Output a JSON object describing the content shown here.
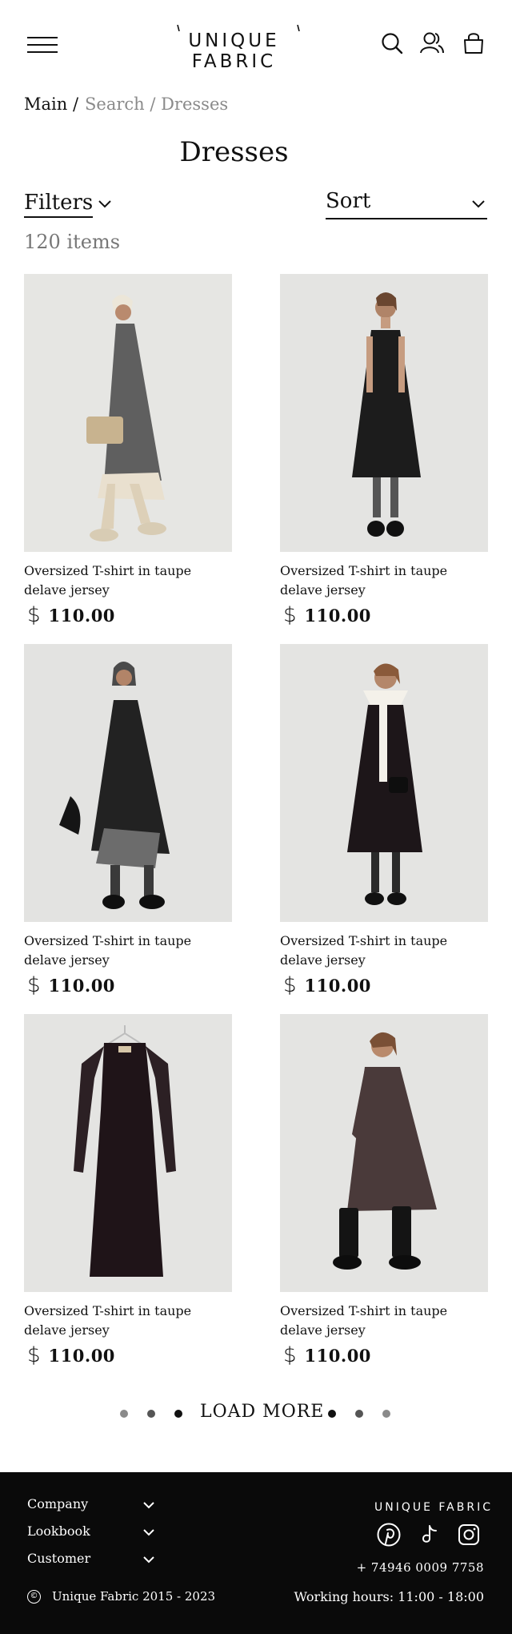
{
  "header": {
    "logo": "UNIQUE FABRIC",
    "icons": [
      "menu-icon",
      "search-icon",
      "user-icon",
      "bag-icon"
    ]
  },
  "breadcrumb": {
    "main": "Main /",
    "rest": "Search / Dresses"
  },
  "page": {
    "title": "Dresses",
    "filters_label": "Filters",
    "sort_label": "Sort",
    "item_count": "120 items"
  },
  "products": [
    {
      "name": "Oversized T-shirt in taupe delave jersey",
      "currency": "$",
      "price": "110.00",
      "dress_color": "#5f5f5f"
    },
    {
      "name": "Oversized T-shirt in taupe delave jersey",
      "currency": "$",
      "price": "110.00",
      "dress_color": "#1c1c1c"
    },
    {
      "name": "Oversized T-shirt in taupe delave jersey",
      "currency": "$",
      "price": "110.00",
      "dress_color": "#222222"
    },
    {
      "name": "Oversized T-shirt in taupe delave jersey",
      "currency": "$",
      "price": "110.00",
      "dress_color": "#1d1619"
    },
    {
      "name": "Oversized T-shirt in taupe delave jersey",
      "currency": "$",
      "price": "110.00",
      "dress_color": "#1f1418"
    },
    {
      "name": "Oversized T-shirt in taupe delave jersey",
      "currency": "$",
      "price": "110.00",
      "dress_color": "#4a3a3a"
    }
  ],
  "pagination": {
    "label": "LOAD MORE",
    "dot_colors": [
      "#8a8a8a",
      "#555555",
      "#111111",
      "#111111",
      "#555555",
      "#8a8a8a"
    ]
  },
  "footer": {
    "menu": [
      "Company",
      "Lookbook",
      "Customer"
    ],
    "copyright": "Unique Fabric 2015 - 2023",
    "copyright_symbol": "©",
    "logo": "UNIQUE FABRIC",
    "social": [
      "pinterest-icon",
      "tiktok-icon",
      "instagram-icon"
    ],
    "phone": "+ 74946 0009 7758",
    "hours": "Working hours: 11:00 - 18:00"
  },
  "colors": {
    "background": "#ffffff",
    "text": "#111111",
    "muted": "#8a8a8a",
    "footer_bg": "#0a0a0a",
    "image_bg": "#e8e8e6"
  }
}
